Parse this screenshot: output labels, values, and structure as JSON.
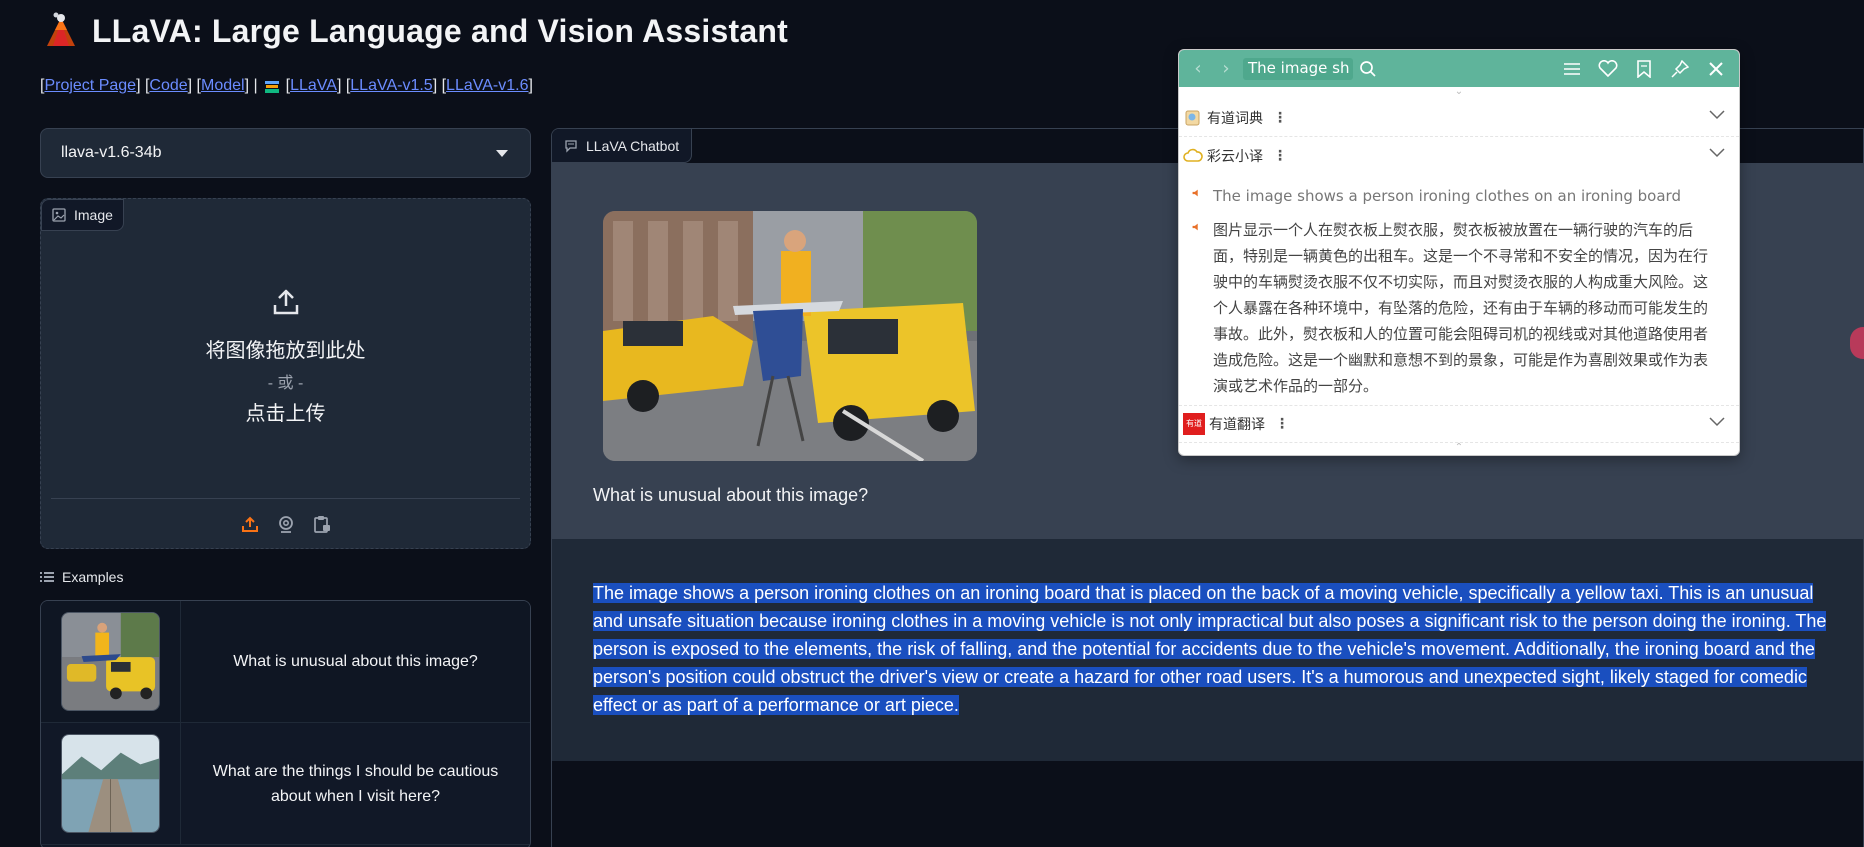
{
  "header": {
    "title": "LLaVA: Large Language and Vision Assistant",
    "links": [
      {
        "label": "Project Page"
      },
      {
        "label": "Code"
      },
      {
        "label": "Model"
      },
      {
        "label": "LLaVA"
      },
      {
        "label": "LLaVA-v1.5"
      },
      {
        "label": "LLaVA-v1.6"
      }
    ]
  },
  "model_select": {
    "value": "llava-v1.6-34b"
  },
  "image_input": {
    "label": "Image",
    "drop_text": "将图像拖放到此处",
    "or_text": "- 或 -",
    "click_text": "点击上传"
  },
  "examples": {
    "label": "Examples",
    "items": [
      {
        "text": "What is unusual about this image?",
        "thumb_icon": "taxi-ironing-thumbnail"
      },
      {
        "text": "What are the things I should be cautious about when I visit here?",
        "thumb_icon": "lake-pier-thumbnail"
      }
    ]
  },
  "chatbot": {
    "label": "LLaVA Chatbot",
    "user_question": "What is unusual about this image?",
    "bot_answer": "The image shows a person ironing clothes on an ironing board that is placed on the back of a moving vehicle, specifically a yellow taxi. This is an unusual and unsafe situation because ironing clothes in a moving vehicle is not only impractical but also poses a significant risk to the person doing the ironing. The person is exposed to the elements, the risk of falling, and the potential for accidents due to the vehicle's movement. Additionally, the ironing board and the person's position could obstruct the driver's view or create a hazard for other road users. It's a humorous and unexpected sight, likely staged for comedic effect or as part of a performance or art piece."
  },
  "dict_popup": {
    "search_text": "The image sh",
    "sections": {
      "dict": "有道词典",
      "caiyun": "彩云小译",
      "youdao_translate": "有道翻译"
    },
    "youdao_badge": "有道",
    "english_line": "The image shows a person ironing clothes on an ironing board",
    "chinese_translation": "图片显示一个人在熨衣板上熨衣服，熨衣板被放置在一辆行驶的汽车的后面，特别是一辆黄色的出租车。这是一个不寻常和不安全的情况，因为在行驶中的车辆熨烫衣服不仅不切实际，而且对熨烫衣服的人构成重大风险。这个人暴露在各种环境中，有坠落的危险，还有由于车辆的移动而可能发生的事故。此外，熨衣板和人的位置可能会阻碍司机的视线或对其他道路使用者造成危险。这是一个幽默和意想不到的景象，可能是作为喜剧效果或作为表演或艺术作品的一部分。"
  },
  "colors": {
    "background": "#0b0f19",
    "panel": "#1f2937",
    "link": "#6b8cff",
    "selection": "#1a4fbf",
    "popup_header": "#5fb49b",
    "upload_accent": "#f97316"
  }
}
